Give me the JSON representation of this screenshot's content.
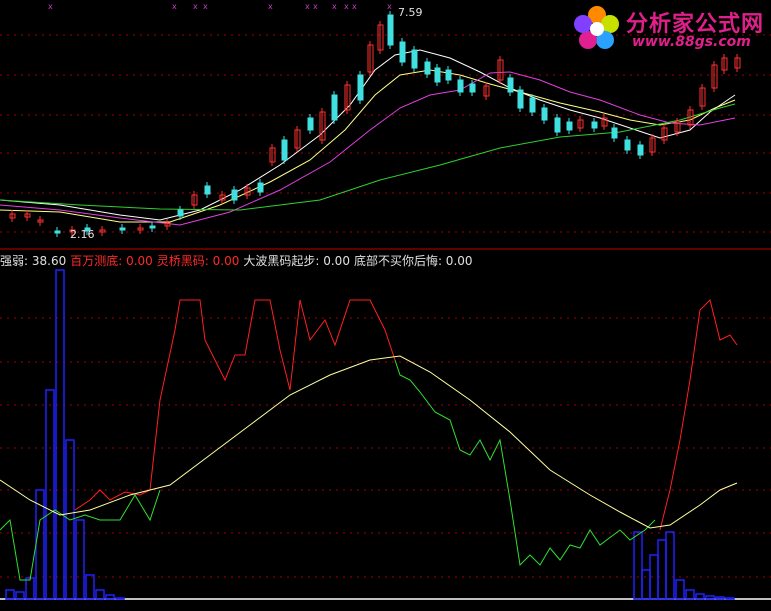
{
  "brand": {
    "name": "分析家公式网",
    "url": "www.88gs.com"
  },
  "price_panel": {
    "high_label": "7.59",
    "low_label": "2.16"
  },
  "indicators": [
    {
      "label": "强弱:",
      "value": "38.60",
      "color": "#e0e0e0"
    },
    {
      "label": "百万测底:",
      "value": "0.00",
      "color": "#ff2a2a"
    },
    {
      "label": "灵桥黑码:",
      "value": "0.00",
      "color": "#ff2a2a"
    },
    {
      "label": "大波黑码起步:",
      "value": "0.00",
      "color": "#e0e0e0"
    },
    {
      "label": "底部不买你后悔:",
      "value": "0.00",
      "color": "#e0e0e0"
    }
  ],
  "colors": {
    "up": "#ff3030",
    "down": "#40e0e0",
    "ma5": "#ffffff",
    "ma10": "#ffff80",
    "ma20": "#e040e0",
    "ma60": "#30d030",
    "grid": "#a00000",
    "bars": "#2020ff",
    "red_line": "#ff2020",
    "green_line": "#30e030",
    "yellow_line": "#ffffa0",
    "marker": "#c040c0"
  }
}
